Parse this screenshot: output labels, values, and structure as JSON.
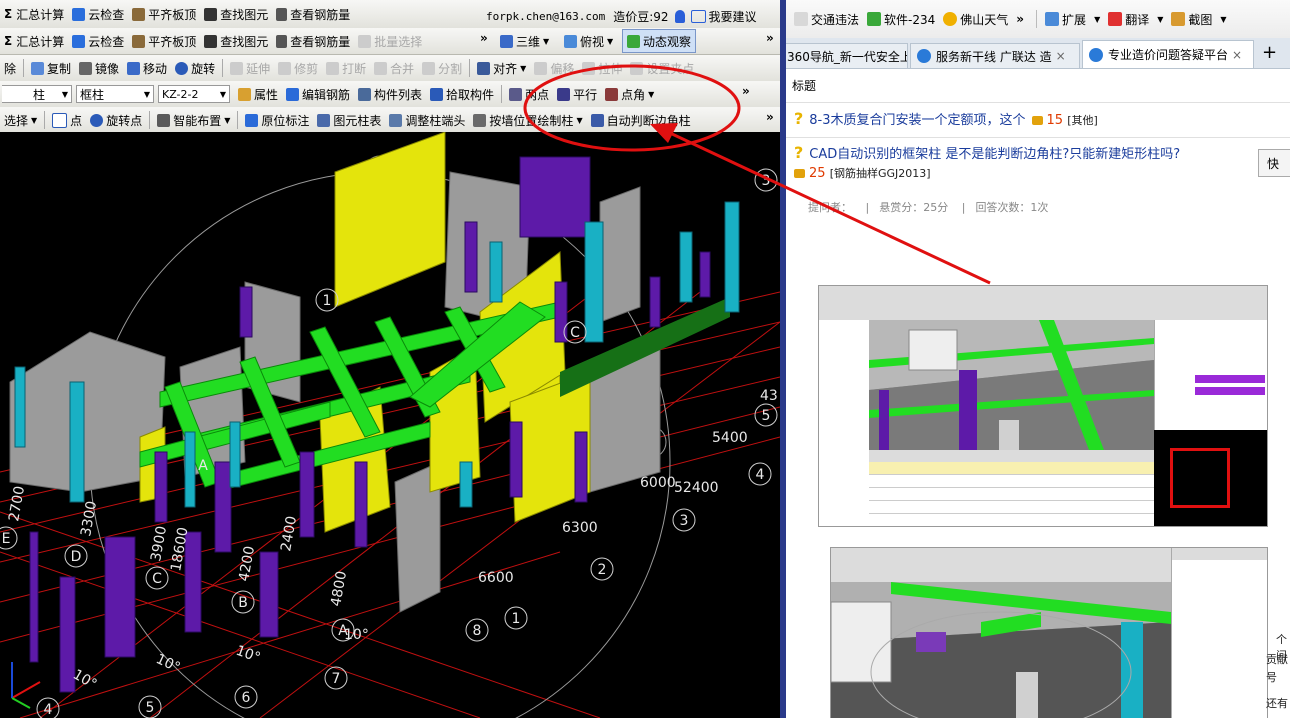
{
  "account": {
    "email": "forpk.chen@163.com",
    "balance_label": "造价豆:92",
    "feedback_label": "我要建议"
  },
  "toolbar1": {
    "summary": "汇总计算",
    "cloud_check": "云检查",
    "flat_slab": "平齐板顶",
    "find_element": "查找图元",
    "view_rebar": "查看钢筋量",
    "batch_select": "批量选择",
    "view_3d": "三维",
    "top_view": "俯视",
    "dynamic_observe": "动态观察"
  },
  "toolbar2": {
    "delete": "除",
    "copy": "复制",
    "mirror": "镜像",
    "move": "移动",
    "rotate": "旋转",
    "extend": "延伸",
    "trim": "修剪",
    "break": "打断",
    "merge": "合并",
    "split": "分割",
    "align": "对齐",
    "offset": "偏移",
    "stretch": "拉伸",
    "set_point": "设置夹点"
  },
  "toolbar3": {
    "type": "柱",
    "subtype": "框柱",
    "name": "KZ-2-2",
    "attributes": "属性",
    "edit_rebar": "编辑钢筋",
    "member_list": "构件列表",
    "pick_member": "拾取构件",
    "two_points": "两点",
    "parallel": "平行",
    "point_angle": "点角"
  },
  "toolbar4": {
    "select": "选择",
    "point": "点",
    "rotate_point": "旋转点",
    "smart_layout": "智能布置",
    "in_place_label": "原位标注",
    "element_table": "图元柱表",
    "adjust_column_end": "调整柱端头",
    "draw_by_wall": "按墙位置绘制柱",
    "auto_corner_column": "自动判断边角柱"
  },
  "viewport": {
    "dims": [
      "2700",
      "3300",
      "3900",
      "18600",
      "4200",
      "4800",
      "2400",
      "5400",
      "6000",
      "52400",
      "6300",
      "6600",
      "43"
    ],
    "grid_letters": [
      "E",
      "D",
      "C",
      "B",
      "A",
      "A",
      "C"
    ],
    "grid_numbers": [
      "1",
      "2",
      "3",
      "4",
      "5",
      "3",
      "5",
      "6",
      "7",
      "8",
      "1",
      "4"
    ],
    "angles": [
      "10°",
      "10°",
      "10°",
      "10°"
    ]
  },
  "browser": {
    "bookmarks": [
      "交通违法",
      "软件-234",
      "佛山天气",
      "扩展",
      "翻译",
      "截图"
    ],
    "tabs": [
      {
        "label": "360导航_新一代安全上"
      },
      {
        "label": "服务新干线 广联达 造"
      },
      {
        "label": "专业造价问题答疑平台"
      }
    ],
    "new_tab": "+"
  },
  "page": {
    "header": "标题",
    "q1": {
      "title": "8-3木质复合门安装一个定额项，这个",
      "points": "15",
      "category": "[其他]"
    },
    "q2": {
      "title": "CAD自动识别的框架柱 是不是能判断边角柱?只能新建矩形柱吗?",
      "points": "25",
      "category": "[钢筋抽样GGJ2013]"
    },
    "meta": {
      "asker": "提问者：",
      "reward": "悬赏分：25分",
      "answers": "回答次数：1次"
    },
    "fast_btn": "快",
    "clip1": "个问",
    "clip2": "贡献",
    "clip3": "号",
    "clip4": "还有"
  },
  "colors": {
    "column_purple": "#5d1aa8",
    "column_cyan": "#19b0c4",
    "beam_green": "#22dd22",
    "wall_yellow": "#e4e40c",
    "wall_gray": "#9b9b9b",
    "annotation_red": "#e01010"
  }
}
